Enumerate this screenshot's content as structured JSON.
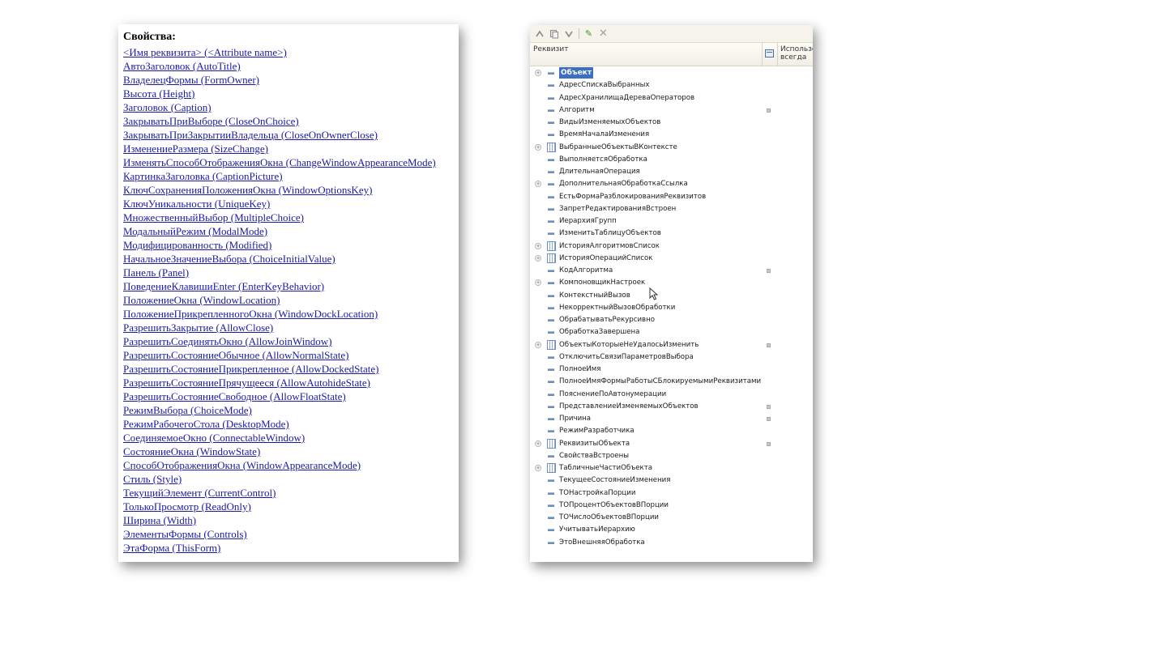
{
  "properties": {
    "title": "Свойства:",
    "items": [
      "<Имя реквизита> (<Attribute name>)",
      "АвтоЗаголовок (AutoTitle)",
      "ВладелецФормы (FormOwner)",
      "Высота (Height)",
      "Заголовок (Caption)",
      "ЗакрыватьПриВыборе (CloseOnChoice)",
      "ЗакрыватьПриЗакрытииВладельца (CloseOnOwnerClose)",
      "ИзменениеРазмера (SizeChange)",
      "ИзменятьСпособОтображенияОкна (ChangeWindowAppearanceMode)",
      "КартинкаЗаголовка (CaptionPicture)",
      "КлючСохраненияПоложенияОкна (WindowOptionsKey)",
      "КлючУникальности (UniqueKey)",
      "МножественныйВыбор (MultipleChoice)",
      "МодальныйРежим (ModalMode)",
      "Модифицированность (Modified)",
      "НачальноеЗначениеВыбора (ChoiceInitialValue)",
      "Панель (Panel)",
      "ПоведениеКлавишиEnter (EnterKeyBehavior)",
      "ПоложениеОкна (WindowLocation)",
      "ПоложениеПрикрепленногоОкна (WindowDockLocation)",
      "РазрешитьЗакрытие (AllowClose)",
      "РазрешитьСоединятьОкно (AllowJoinWindow)",
      "РазрешитьСостояниеОбычное (AllowNormalState)",
      "РазрешитьСостояниеПрикрепленное (AllowDockedState)",
      "РазрешитьСостояниеПрячущееся (AllowAutohideState)",
      "РазрешитьСостояниеСвободное (AllowFloatState)",
      "РежимВыбора (ChoiceMode)",
      "РежимРабочегоСтола (DesktopMode)",
      "СоединяемоеОкно (ConnectableWindow)",
      "СостояниеОкна (WindowState)",
      "СпособОтображенияОкна (WindowAppearanceMode)",
      "Стиль (Style)",
      "ТекущийЭлемент (CurrentControl)",
      "ТолькоПросмотр (ReadOnly)",
      "Ширина (Width)",
      "ЭлементыФормы (Controls)",
      "ЭтаФорма (ThisForm)"
    ]
  },
  "tree": {
    "toolbar": {
      "icons": [
        "move-up-icon",
        "copy-icon",
        "move-down-icon",
        "edit-icon",
        "delete-icon"
      ],
      "edit_glyph": "✎",
      "delete_glyph": "✕"
    },
    "header": {
      "attribute": "Реквизит",
      "use_always_line1": "Использо",
      "use_always_line2": "всегда"
    },
    "rows": [
      {
        "label": "Объект",
        "icon": "attr",
        "expand": true,
        "use": false,
        "selected": true
      },
      {
        "label": "АдресСпискаВыбранных",
        "icon": "attr",
        "expand": false,
        "use": false
      },
      {
        "label": "АдресХранилищаДереваОператоров",
        "icon": "attr",
        "expand": false,
        "use": false
      },
      {
        "label": "Алгоритм",
        "icon": "attr",
        "expand": false,
        "use": true
      },
      {
        "label": "ВидыИзменяемыхОбъектов",
        "icon": "attr",
        "expand": false,
        "use": false
      },
      {
        "label": "ВремяНачалаИзменения",
        "icon": "attr",
        "expand": false,
        "use": false
      },
      {
        "label": "ВыбранныеОбъектыВКонтексте",
        "icon": "table",
        "expand": true,
        "use": false
      },
      {
        "label": "ВыполняетсяОбработка",
        "icon": "attr",
        "expand": false,
        "use": false
      },
      {
        "label": "ДлительнаяОперация",
        "icon": "attr",
        "expand": false,
        "use": false
      },
      {
        "label": "ДополнительнаяОбработкаСсылка",
        "icon": "attr",
        "expand": true,
        "use": false
      },
      {
        "label": "ЕстьФормаРазблокированияРеквизитов",
        "icon": "attr",
        "expand": false,
        "use": false
      },
      {
        "label": "ЗапретРедактированияВстроен",
        "icon": "attr",
        "expand": false,
        "use": false
      },
      {
        "label": "ИерархияГрупп",
        "icon": "attr",
        "expand": false,
        "use": false
      },
      {
        "label": "ИзменитьТаблицуОбъектов",
        "icon": "attr",
        "expand": false,
        "use": false
      },
      {
        "label": "ИсторияАлгоритмовСписок",
        "icon": "table",
        "expand": true,
        "use": false
      },
      {
        "label": "ИсторияОперацийСписок",
        "icon": "table",
        "expand": true,
        "use": false
      },
      {
        "label": "КодАлгоритма",
        "icon": "attr",
        "expand": false,
        "use": true
      },
      {
        "label": "КомпоновщикНастроек",
        "icon": "attr",
        "expand": true,
        "use": false
      },
      {
        "label": "КонтекстныйВызов",
        "icon": "attr",
        "expand": false,
        "use": false
      },
      {
        "label": "НекорректныйВызовОбработки",
        "icon": "attr",
        "expand": false,
        "use": false
      },
      {
        "label": "ОбрабатыватьРекурсивно",
        "icon": "attr",
        "expand": false,
        "use": false
      },
      {
        "label": "ОбработкаЗавершена",
        "icon": "attr",
        "expand": false,
        "use": false
      },
      {
        "label": "ОбъектыКоторыеНеУдалосьИзменить",
        "icon": "table",
        "expand": true,
        "use": true
      },
      {
        "label": "ОтключитьСвязиПараметровВыбора",
        "icon": "attr",
        "expand": false,
        "use": false
      },
      {
        "label": "ПолноеИмя",
        "icon": "attr",
        "expand": false,
        "use": false
      },
      {
        "label": "ПолноеИмяФормыРаботыСБлокируемымиРеквизитами",
        "icon": "attr",
        "expand": false,
        "use": false
      },
      {
        "label": "ПояснениеПоАвтонумерации",
        "icon": "attr",
        "expand": false,
        "use": false
      },
      {
        "label": "ПредставлениеИзменяемыхОбъектов",
        "icon": "attr",
        "expand": false,
        "use": true
      },
      {
        "label": "Причина",
        "icon": "attr",
        "expand": false,
        "use": true
      },
      {
        "label": "РежимРазработчика",
        "icon": "attr",
        "expand": false,
        "use": false
      },
      {
        "label": "РеквизитыОбъекта",
        "icon": "table",
        "expand": true,
        "use": true
      },
      {
        "label": "СвойстваВстроены",
        "icon": "attr",
        "expand": false,
        "use": false
      },
      {
        "label": "ТабличныеЧастиОбъекта",
        "icon": "table",
        "expand": true,
        "use": false
      },
      {
        "label": "ТекущееСостояниеИзменения",
        "icon": "attr",
        "expand": false,
        "use": false
      },
      {
        "label": "ТОНастройкаПорции",
        "icon": "attr",
        "expand": false,
        "use": false
      },
      {
        "label": "ТОПроцентОбъектовВПорции",
        "icon": "attr",
        "expand": false,
        "use": false
      },
      {
        "label": "ТОЧислоОбъектовВПорции",
        "icon": "attr",
        "expand": false,
        "use": false
      },
      {
        "label": "УчитыватьИерархию",
        "icon": "attr",
        "expand": false,
        "use": false
      },
      {
        "label": "ЭтоВнешняяОбработка",
        "icon": "attr",
        "expand": false,
        "use": false
      }
    ]
  },
  "colors": {
    "link": "#1a1aa6",
    "selection": "#3c6fc4",
    "icon_blue": "#6d8fb8"
  }
}
